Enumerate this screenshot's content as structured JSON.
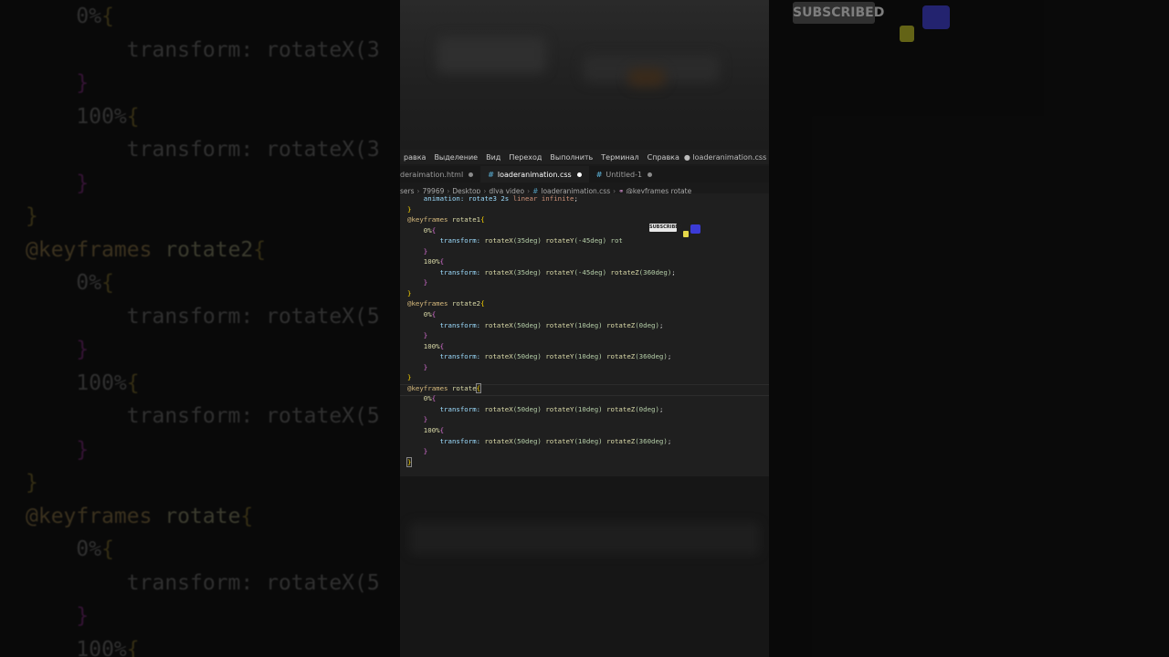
{
  "background": {
    "lines": [
      [
        {
          "t": "    0%",
          "c": ""
        },
        {
          "t": "{",
          "c": "br"
        }
      ],
      [
        {
          "t": "        transform: rotateX(3",
          "c": ""
        }
      ],
      [
        {
          "t": "    }",
          "c": "pr"
        }
      ],
      [
        {
          "t": "    100%",
          "c": ""
        },
        {
          "t": "{",
          "c": "br"
        }
      ],
      [
        {
          "t": "        transform: rotateX(3",
          "c": ""
        }
      ],
      [
        {
          "t": "    }",
          "c": "pr"
        }
      ],
      [
        {
          "t": "}",
          "c": "br"
        }
      ],
      [
        {
          "t": "@keyframes ",
          "c": "kw"
        },
        {
          "t": "rotate2",
          "c": "fn"
        },
        {
          "t": "{",
          "c": "br"
        }
      ],
      [
        {
          "t": "    0%",
          "c": ""
        },
        {
          "t": "{",
          "c": "br"
        }
      ],
      [
        {
          "t": "        transform: rotateX(5",
          "c": ""
        }
      ],
      [
        {
          "t": "    }",
          "c": "pr"
        }
      ],
      [
        {
          "t": "    100%",
          "c": ""
        },
        {
          "t": "{",
          "c": "br"
        }
      ],
      [
        {
          "t": "        transform: rotateX(5",
          "c": ""
        }
      ],
      [
        {
          "t": "    }",
          "c": "pr"
        }
      ],
      [
        {
          "t": "}",
          "c": "br"
        }
      ],
      [
        {
          "t": "@keyframes ",
          "c": "kw"
        },
        {
          "t": "rotate",
          "c": "fn"
        },
        {
          "t": "{",
          "c": "br"
        }
      ],
      [
        {
          "t": "    0%",
          "c": ""
        },
        {
          "t": "{",
          "c": "br"
        }
      ],
      [
        {
          "t": "        transform: rotateX(5",
          "c": ""
        }
      ],
      [
        {
          "t": "    }",
          "c": "pr"
        }
      ],
      [
        {
          "t": "    100%",
          "c": ""
        },
        {
          "t": "{",
          "c": "br"
        }
      ]
    ],
    "subscribed_label": "SUBSCRIBED"
  },
  "menubar": {
    "items": [
      "равка",
      "Выделение",
      "Вид",
      "Переход",
      "Выполнить",
      "Терминал",
      "Справка"
    ],
    "window_title": "● loaderanimation.css - (Раб"
  },
  "tabs": [
    {
      "label": "deraimation.html",
      "icon": "",
      "active": false,
      "modified": true
    },
    {
      "label": "loaderanimation.css",
      "icon": "#",
      "active": true,
      "modified": true
    },
    {
      "label": "Untitled-1",
      "icon": "#",
      "active": false,
      "modified": true
    }
  ],
  "breadcrumb": {
    "parts": [
      "sers",
      "79969",
      "Desktop",
      "dlya video",
      "loaderanimation.css",
      "@keyframes rotate"
    ]
  },
  "code_lines": [
    [
      {
        "t": "    animation: rotate3 2s ",
        "c": "k-prop"
      },
      {
        "t": "linear infinite",
        "c": "k-val"
      },
      {
        "t": ";",
        "c": ""
      }
    ],
    [
      {
        "t": "}",
        "c": "k-p"
      }
    ],
    [
      {
        "t": "@keyframes ",
        "c": "k-kw"
      },
      {
        "t": "rotate1",
        "c": "k-name"
      },
      {
        "t": "{",
        "c": "k-p"
      }
    ],
    [
      {
        "t": "    0%",
        "c": "k-name"
      },
      {
        "t": "{",
        "c": "k-p2"
      }
    ],
    [
      {
        "t": "        transform: ",
        "c": "k-prop"
      },
      {
        "t": "rotateX",
        "c": "k-fn"
      },
      {
        "t": "(35deg) ",
        "c": "k-num"
      },
      {
        "t": "rotateY",
        "c": "k-fn"
      },
      {
        "t": "(-45deg) rot",
        "c": "k-num"
      }
    ],
    [
      {
        "t": "    }",
        "c": "k-p2"
      }
    ],
    [
      {
        "t": "    100%",
        "c": "k-name"
      },
      {
        "t": "{",
        "c": "k-p2"
      }
    ],
    [
      {
        "t": "        transform: ",
        "c": "k-prop"
      },
      {
        "t": "rotateX",
        "c": "k-fn"
      },
      {
        "t": "(35deg) ",
        "c": "k-num"
      },
      {
        "t": "rotateY",
        "c": "k-fn"
      },
      {
        "t": "(-45deg) ",
        "c": "k-num"
      },
      {
        "t": "rotateZ",
        "c": "k-fn"
      },
      {
        "t": "(360deg)",
        "c": "k-num"
      },
      {
        "t": ";",
        "c": ""
      }
    ],
    [
      {
        "t": "    }",
        "c": "k-p2"
      }
    ],
    [
      {
        "t": "}",
        "c": "k-p"
      }
    ],
    [
      {
        "t": "@keyframes ",
        "c": "k-kw"
      },
      {
        "t": "rotate2",
        "c": "k-name"
      },
      {
        "t": "{",
        "c": "k-p"
      }
    ],
    [
      {
        "t": "    0%",
        "c": "k-name"
      },
      {
        "t": "{",
        "c": "k-p2"
      }
    ],
    [
      {
        "t": "        transform: ",
        "c": "k-prop"
      },
      {
        "t": "rotateX",
        "c": "k-fn"
      },
      {
        "t": "(50deg) ",
        "c": "k-num"
      },
      {
        "t": "rotateY",
        "c": "k-fn"
      },
      {
        "t": "(10deg) ",
        "c": "k-num"
      },
      {
        "t": "rotateZ",
        "c": "k-fn"
      },
      {
        "t": "(0deg)",
        "c": "k-num"
      },
      {
        "t": ";",
        "c": ""
      }
    ],
    [
      {
        "t": "    }",
        "c": "k-p2"
      }
    ],
    [
      {
        "t": "    100%",
        "c": "k-name"
      },
      {
        "t": "{",
        "c": "k-p2"
      }
    ],
    [
      {
        "t": "        transform: ",
        "c": "k-prop"
      },
      {
        "t": "rotateX",
        "c": "k-fn"
      },
      {
        "t": "(50deg) ",
        "c": "k-num"
      },
      {
        "t": "rotateY",
        "c": "k-fn"
      },
      {
        "t": "(10deg) ",
        "c": "k-num"
      },
      {
        "t": "rotateZ",
        "c": "k-fn"
      },
      {
        "t": "(360deg)",
        "c": "k-num"
      },
      {
        "t": ";",
        "c": ""
      }
    ],
    [
      {
        "t": "    }",
        "c": "k-p2"
      }
    ],
    [
      {
        "t": "}",
        "c": "k-p"
      }
    ],
    [
      {
        "t": "@keyframes ",
        "c": "k-kw"
      },
      {
        "t": "rotate",
        "c": "k-name"
      },
      {
        "t": "{",
        "c": "k-p caret-box"
      }
    ],
    [
      {
        "t": "    0%",
        "c": "k-name"
      },
      {
        "t": "{",
        "c": "k-p2"
      }
    ],
    [
      {
        "t": "        transform: ",
        "c": "k-prop"
      },
      {
        "t": "rotateX",
        "c": "k-fn"
      },
      {
        "t": "(50deg) ",
        "c": "k-num"
      },
      {
        "t": "rotateY",
        "c": "k-fn"
      },
      {
        "t": "(10deg) ",
        "c": "k-num"
      },
      {
        "t": "rotateZ",
        "c": "k-fn"
      },
      {
        "t": "(0deg)",
        "c": "k-num"
      },
      {
        "t": ";",
        "c": ""
      }
    ],
    [
      {
        "t": "    }",
        "c": "k-p2"
      }
    ],
    [
      {
        "t": "    100%",
        "c": "k-name"
      },
      {
        "t": "{",
        "c": "k-p2"
      }
    ],
    [
      {
        "t": "        transform: ",
        "c": "k-prop"
      },
      {
        "t": "rotateX",
        "c": "k-fn"
      },
      {
        "t": "(50deg) ",
        "c": "k-num"
      },
      {
        "t": "rotateY",
        "c": "k-fn"
      },
      {
        "t": "(10deg) ",
        "c": "k-num"
      },
      {
        "t": "rotateZ",
        "c": "k-fn"
      },
      {
        "t": "(360deg)",
        "c": "k-num"
      },
      {
        "t": ";",
        "c": ""
      }
    ],
    [
      {
        "t": "    }",
        "c": "k-p2"
      }
    ],
    [
      {
        "t": "}",
        "c": "k-p caret-box"
      }
    ]
  ],
  "overlay": {
    "subscribed_label": "SUBSCRIBED",
    "like_icon": "thumbs-up-icon",
    "cursor_icon": "pointer-icon"
  }
}
